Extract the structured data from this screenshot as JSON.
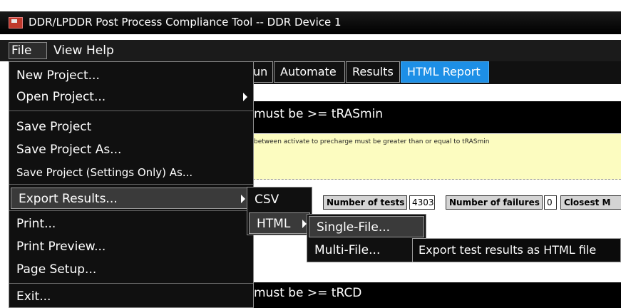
{
  "window": {
    "title": "DDR/LPDDR Post Process Compliance Tool -- DDR Device 1",
    "icon": "app-logo-icon"
  },
  "menubar": {
    "file": "File",
    "view": "View",
    "help": "Help"
  },
  "tabs": {
    "run": "un",
    "automate": "Automate",
    "results": "Results",
    "html_report": "HTML Report"
  },
  "content": {
    "requirement_1": "must be >= tRASmin",
    "note": "between activate to precharge must be greater than or equal to tRASmin",
    "stats": {
      "tests_label": "Number of tests",
      "tests_value": "4303",
      "failures_label": "Number of failures",
      "failures_value": "0",
      "closest_label": "Closest M"
    },
    "requirement_2": "must be >= tRCD"
  },
  "file_menu": {
    "new_project": "New Project...",
    "open_project": "Open Project...",
    "save_project": "Save Project",
    "save_project_as": "Save Project As...",
    "save_settings_only": "Save Project (Settings Only) As...",
    "export_results": "Export Results...",
    "print": "Print...",
    "print_preview": "Print Preview...",
    "page_setup": "Page Setup...",
    "exit": "Exit..."
  },
  "export_submenu": {
    "csv": "CSV",
    "html": "HTML"
  },
  "html_submenu": {
    "single_file": "Single-File...",
    "multi_file": "Multi-File..."
  },
  "tooltip": "Export test results as HTML file",
  "colors": {
    "accent_tab": "#1d8fe6",
    "note_background": "#fcfcc0",
    "menu_background": "#101010"
  }
}
